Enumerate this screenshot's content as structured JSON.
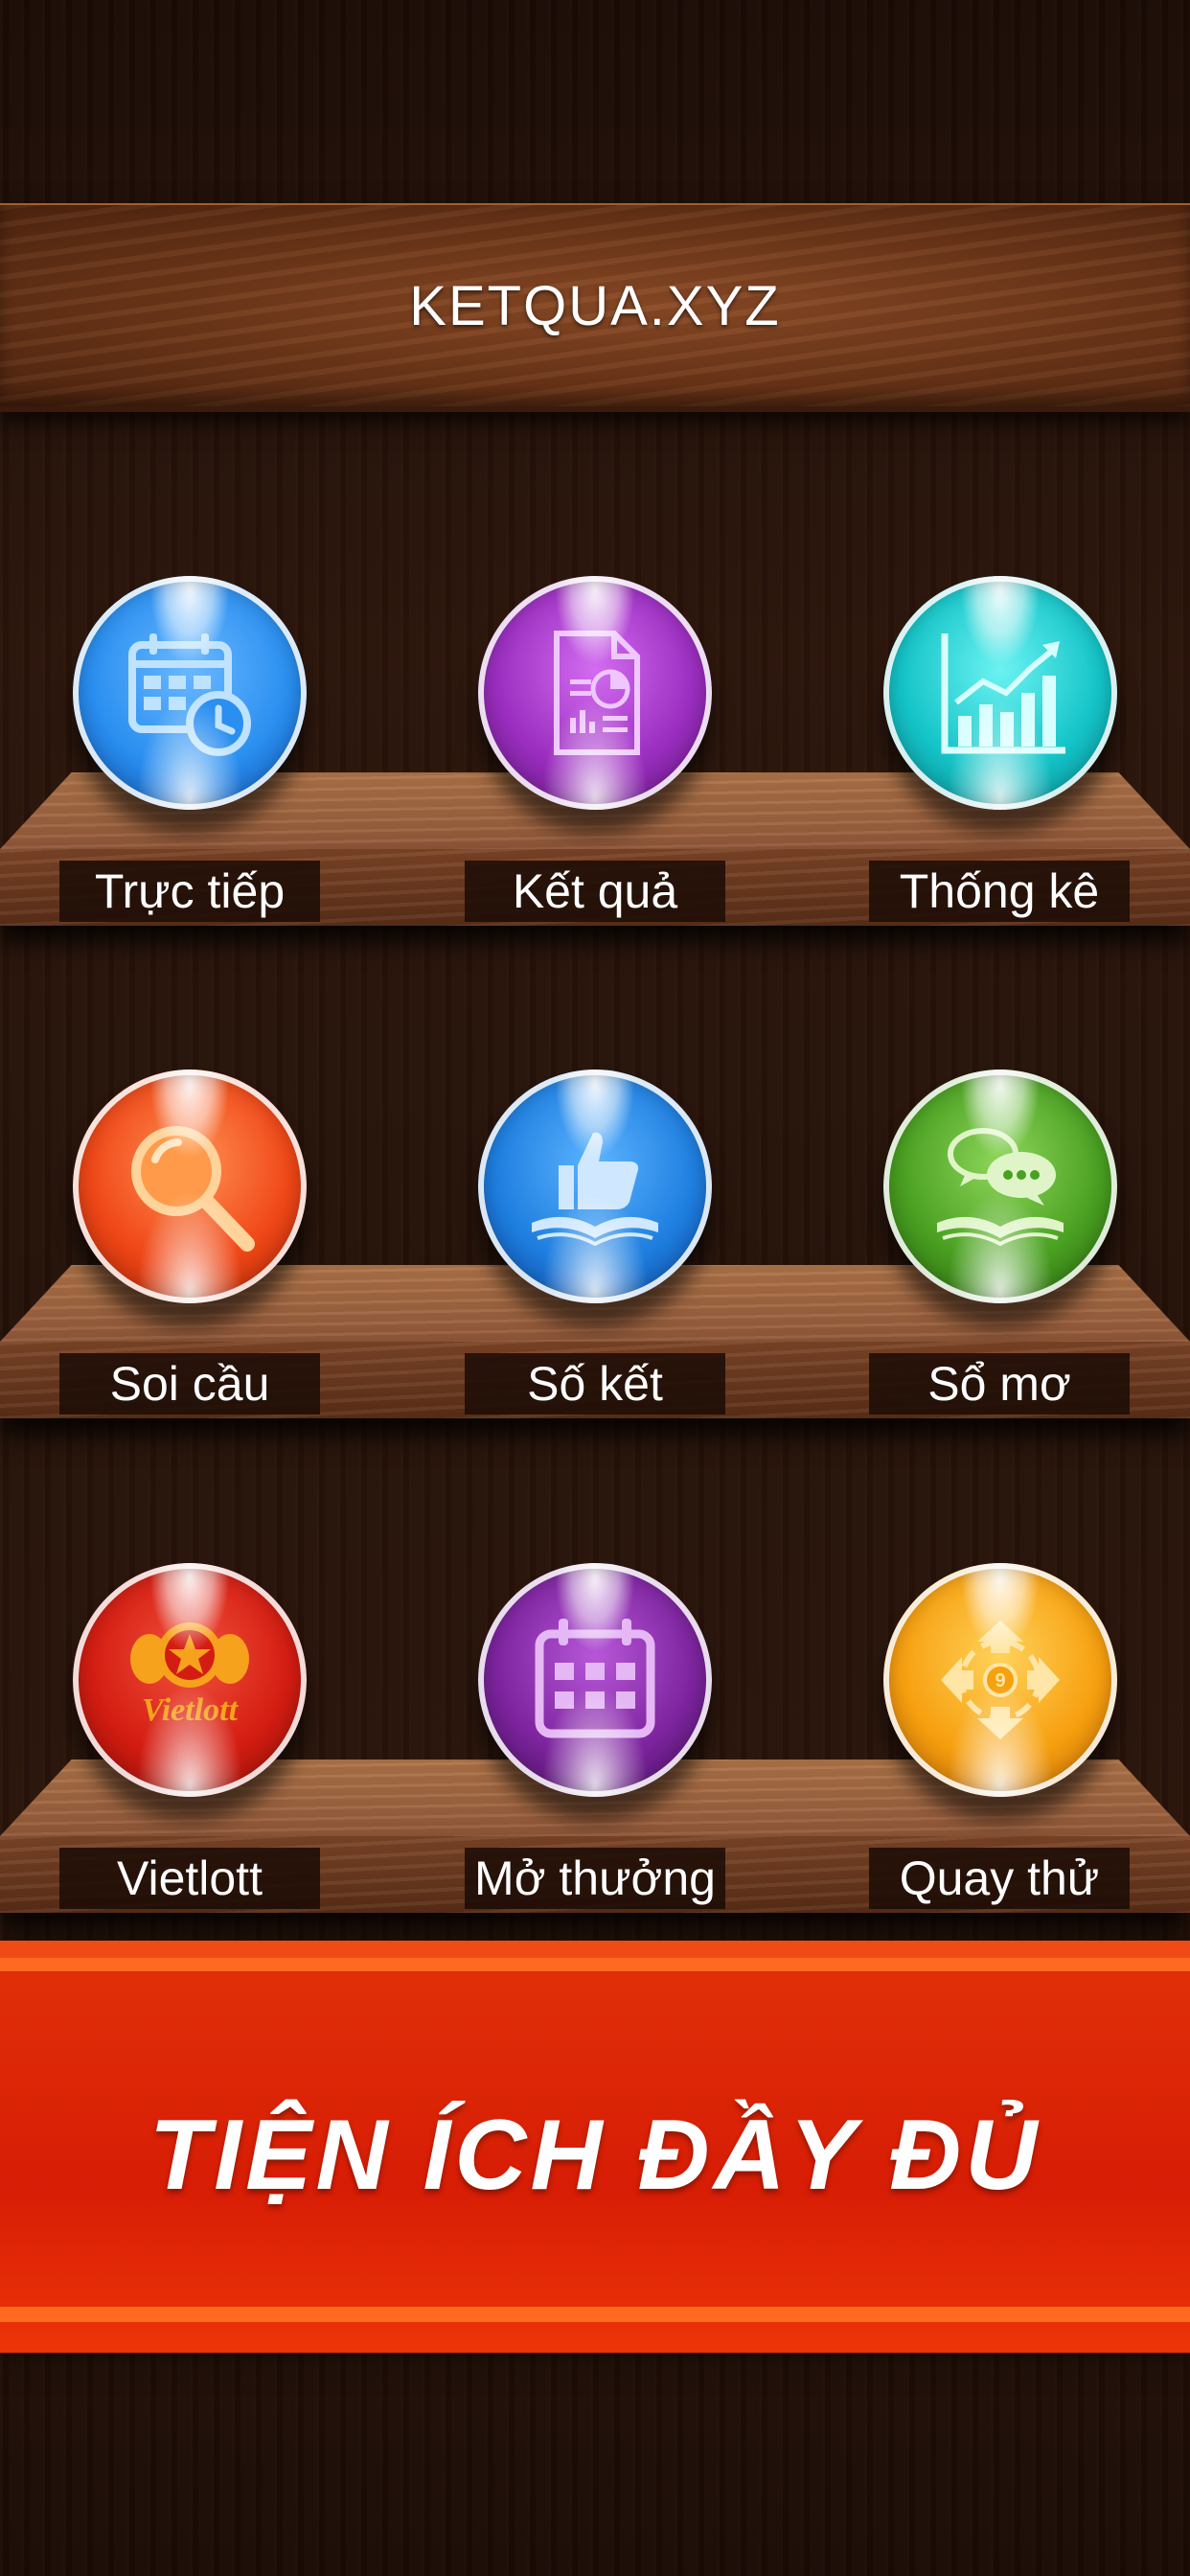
{
  "header": {
    "title": "KETQUA.XYZ"
  },
  "menu": [
    {
      "label": "Trực tiếp",
      "icon": "calendar-clock-icon",
      "color": "#2a8ff0"
    },
    {
      "label": "Kết quả",
      "icon": "report-document-icon",
      "color": "#9b2ec0"
    },
    {
      "label": "Thống kê",
      "icon": "bar-chart-icon",
      "color": "#14c4c8"
    },
    {
      "label": "Soi cầu",
      "icon": "magnifier-icon",
      "color": "#f04818"
    },
    {
      "label": "Số kết",
      "icon": "thumbs-up-book-icon",
      "color": "#1f7fe0"
    },
    {
      "label": "Sổ mơ",
      "icon": "chat-book-icon",
      "color": "#4aa022"
    },
    {
      "label": "Vietlott",
      "icon": "vietlott-logo",
      "color": "#d41d12",
      "logo_text": "Vietlott"
    },
    {
      "label": "Mở thưởng",
      "icon": "calendar-grid-icon",
      "color": "#7d249e"
    },
    {
      "label": "Quay thử",
      "icon": "spin-ball-icon",
      "color": "#f7a010",
      "ball_number": "9"
    }
  ],
  "banner": {
    "text": "TIỆN ÍCH ĐẦY ĐỦ"
  }
}
